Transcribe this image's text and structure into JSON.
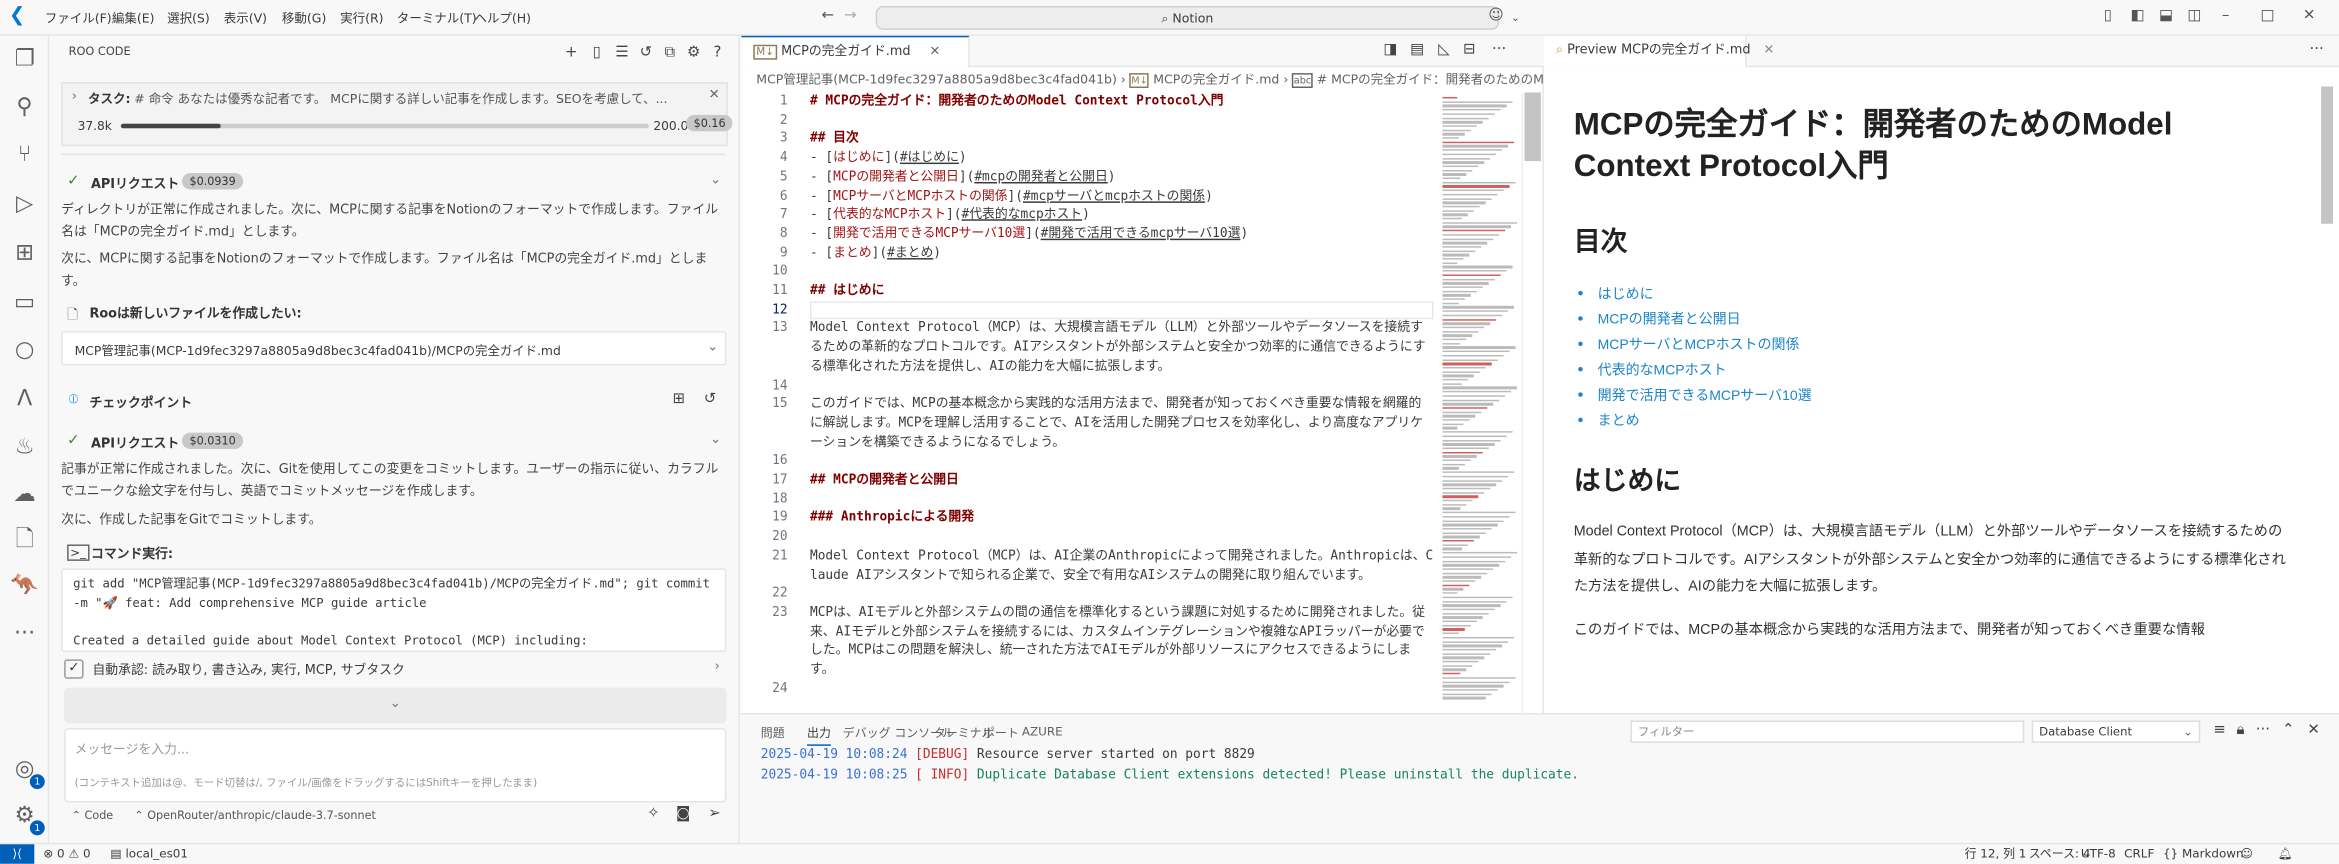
{
  "titlebar": {
    "menu": [
      "ファイル(F)",
      "編集(E)",
      "選択(S)",
      "表示(V)",
      "移動(G)",
      "実行(R)",
      "ターミナル(T)",
      "ヘルプ(H)"
    ],
    "search": "Notion"
  },
  "roo": {
    "title": "ROO CODE",
    "task": {
      "label": "タスク:",
      "text": "# 命令 あなたは優秀な記者です。 MCPに関する詳しい記事を作成します。SEOを考慮して、...",
      "tokens_used": "37.8k",
      "tokens_max": "200.0k",
      "context_fraction": 0.189,
      "cost": "$0.16"
    },
    "api1": {
      "label": "APIリクエスト",
      "cost": "$0.0939"
    },
    "para1": "ディレクトリが正常に作成されました。次に、MCPに関する記事をNotionのフォーマットで作成します。ファイル名は「MCPの完全ガイド.md」とします。",
    "para2": "次に、MCPに関する記事をNotionのフォーマットで作成します。ファイル名は「MCPの完全ガイド.md」とします。",
    "new_file_label": "Rooは新しいファイルを作成したい:",
    "new_file_path": "MCP管理記事(MCP-1d9fec3297a8805a9d8bec3c4fad041b)/MCPの完全ガイド.md",
    "checkpoint": "チェックポイント",
    "api2": {
      "label": "APIリクエスト",
      "cost": "$0.0310"
    },
    "para3": "記事が正常に作成されました。次に、Gitを使用してこの変更をコミットします。ユーザーの指示に従い、カラフルでユニークな絵文字を付与し、英語でコミットメッセージを作成します。",
    "para4": "次に、作成した記事をGitでコミットします。",
    "command_label": "コマンド実行:",
    "command_lines": [
      "git add \"MCP管理記事(MCP-1d9fec3297a8805a9d8bec3c4fad041b)/MCPの完全ガイド.md\"; git commit -m \"🚀 feat: Add comprehensive MCP guide article",
      "",
      "Created a detailed guide about Model Context Protocol (MCP) including:"
    ],
    "auto_approve": "自動承認: 読み取り, 書き込み, 実行, MCP, サブタスク",
    "input_placeholder": "メッセージを入力...",
    "input_hint": "(コンテキスト追加は@、モード切替は/, ファイル/画像をドラッグするにはShiftキーを押したまま)",
    "mode": "Code",
    "model": "OpenRouter/anthropic/claude-3.7-sonnet"
  },
  "activity": {
    "account_badge": "1",
    "settings_badge": "1"
  },
  "editor": {
    "tab": "MCPの完全ガイド.md",
    "breadcrumb": [
      "MCP管理記事(MCP-1d9fec3297a8805a9d8bec3c4fad041b)",
      "MCPの完全ガイド.md",
      "# MCPの完全ガイド：開発者のためのModel Con"
    ],
    "current_line": 12,
    "lines": [
      {
        "n": 1,
        "kind": "h",
        "text": "# MCPの完全ガイド：開発者のためのModel Context Protocol入門"
      },
      {
        "n": 2,
        "kind": "p",
        "text": ""
      },
      {
        "n": 3,
        "kind": "h",
        "text": "## 目次"
      },
      {
        "n": 4,
        "kind": "link",
        "text": "はじめに",
        "url": "#はじめに"
      },
      {
        "n": 5,
        "kind": "link",
        "text": "MCPの開発者と公開日",
        "url": "#mcpの開発者と公開日"
      },
      {
        "n": 6,
        "kind": "link",
        "text": "MCPサーバとMCPホストの関係",
        "url": "#mcpサーバとmcpホストの関係"
      },
      {
        "n": 7,
        "kind": "link",
        "text": "代表的なMCPホスト",
        "url": "#代表的なmcpホスト"
      },
      {
        "n": 8,
        "kind": "link",
        "text": "開発で活用できるMCPサーバ10選",
        "url": "#開発で活用できるmcpサーバ10選"
      },
      {
        "n": 9,
        "kind": "link",
        "text": "まとめ",
        "url": "#まとめ"
      },
      {
        "n": 10,
        "kind": "p",
        "text": ""
      },
      {
        "n": 11,
        "kind": "h",
        "text": "## はじめに"
      },
      {
        "n": 12,
        "kind": "p",
        "text": ""
      },
      {
        "n": 13,
        "kind": "p",
        "text": "Model Context Protocol（MCP）は、大規模言語モデル（LLM）と外部ツールやデータソースを接続するための革新的なプロトコルです。AIアシスタントが外部システムと安全かつ効率的に通信できるようにする標準化された方法を提供し、AIの能力を大幅に拡張します。"
      },
      {
        "n": 14,
        "kind": "p",
        "text": ""
      },
      {
        "n": 15,
        "kind": "p",
        "text": "このガイドでは、MCPの基本概念から実践的な活用方法まで、開発者が知っておくべき重要な情報を網羅的に解説します。MCPを理解し活用することで、AIを活用した開発プロセスを効率化し、より高度なアプリケーションを構築できるようになるでしょう。"
      },
      {
        "n": 16,
        "kind": "p",
        "text": ""
      },
      {
        "n": 17,
        "kind": "h",
        "text": "## MCPの開発者と公開日"
      },
      {
        "n": 18,
        "kind": "p",
        "text": ""
      },
      {
        "n": 19,
        "kind": "h",
        "text": "### Anthropicによる開発"
      },
      {
        "n": 20,
        "kind": "p",
        "text": ""
      },
      {
        "n": 21,
        "kind": "p",
        "text": "Model Context Protocol（MCP）は、AI企業のAnthropicによって開発されました。Anthropicは、Claude AIアシスタントで知られる企業で、安全で有用なAIシステムの開発に取り組んでいます。"
      },
      {
        "n": 22,
        "kind": "p",
        "text": ""
      },
      {
        "n": 23,
        "kind": "p",
        "text": "MCPは、AIモデルと外部システムの間の通信を標準化するという課題に対処するために開発されました。従来、AIモデルと外部システムを接続するには、カスタムインテグレーションや複雑なAPIラッパーが必要でした。MCPはこの問題を解決し、統一された方法でAIモデルが外部リソースにアクセスできるようにします。"
      },
      {
        "n": 24,
        "kind": "p",
        "text": ""
      }
    ]
  },
  "preview": {
    "tab": "Preview MCPの完全ガイド.md",
    "h1": "MCPの完全ガイド：開発者のためのModel Context Protocol入門",
    "toc_title": "目次",
    "toc": [
      "はじめに",
      "MCPの開発者と公開日",
      "MCPサーバとMCPホストの関係",
      "代表的なMCPホスト",
      "開発で活用できるMCPサーバ10選",
      "まとめ"
    ],
    "intro_title": "はじめに",
    "intro_p1": "Model Context Protocol（MCP）は、大規模言語モデル（LLM）と外部ツールやデータソースを接続するための革新的なプロトコルです。AIアシスタントが外部システムと安全かつ効率的に通信できるようにする標準化された方法を提供し、AIの能力を大幅に拡張します。",
    "intro_p2": "このガイドでは、MCPの基本概念から実践的な活用方法まで、開発者が知っておくべき重要な情報"
  },
  "panel": {
    "tabs": [
      "問題",
      "出力",
      "デバッグ コンソール",
      "ターミナル",
      "ポート",
      "AZURE"
    ],
    "active_tab": "出力",
    "filter_placeholder": "フィルター",
    "channel": "Database Client",
    "logs": [
      {
        "time": "2025-04-19 10:08:24",
        "level": "[DEBUG]",
        "msg": "Resource server started on port 8829"
      },
      {
        "time": "2025-04-19 10:08:25",
        "level": "[ INFO]",
        "msg": "Duplicate Database Client extensions detected! Please uninstall the duplicate."
      }
    ]
  },
  "status": {
    "errors": "0",
    "warnings": "0",
    "connection": "local_es01",
    "position": "行 12, 列 1",
    "spaces": "スペース: 4",
    "encoding": "UTF-8",
    "eol": "CRLF",
    "language": "Markdown"
  },
  "colors": {
    "accent": "#005fb8",
    "heading": "#800000",
    "link": "#a31515",
    "preview_link": "#1a85c8",
    "log_time": "#3a6fd8",
    "log_level": "#c72e2e",
    "log_info": "#16825d"
  }
}
